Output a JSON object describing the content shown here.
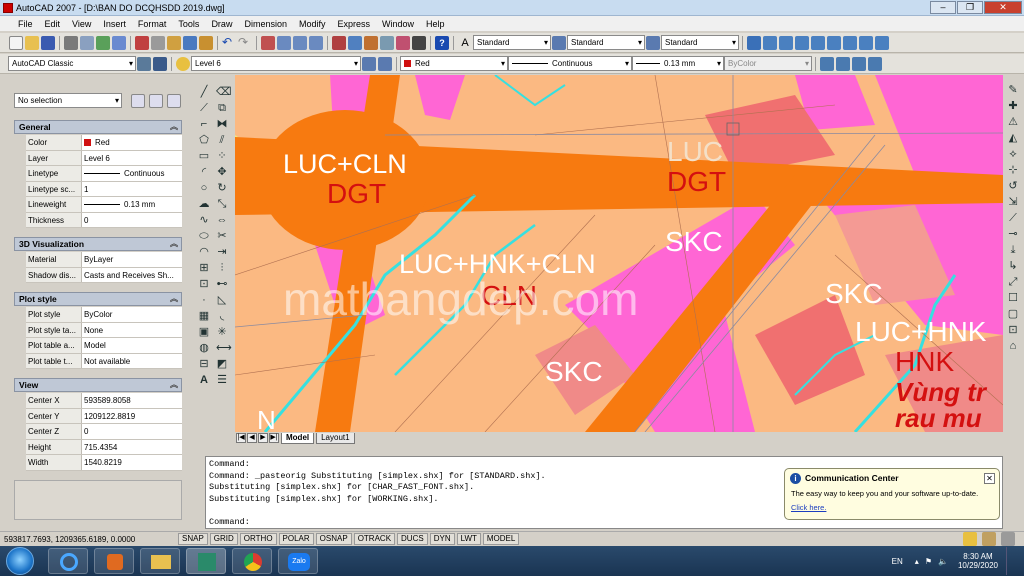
{
  "window": {
    "title": "AutoCAD 2007 - [D:\\BAN DO DCQHSDD 2019.dwg]"
  },
  "menu": [
    "File",
    "Edit",
    "View",
    "Insert",
    "Format",
    "Tools",
    "Draw",
    "Dimension",
    "Modify",
    "Express",
    "Window",
    "Help"
  ],
  "toolbar": {
    "text_style": "Standard",
    "dim_style": "Standard",
    "table_style": "Standard",
    "workspace": "AutoCAD Classic",
    "layer": "Level 6",
    "color": "Red",
    "linetype": "Continuous",
    "lineweight": "0.13 mm",
    "plotstyle": "ByColor"
  },
  "properties": {
    "selection": "No selection",
    "sections": [
      {
        "title": "General",
        "rows": [
          {
            "key": "Color",
            "value": "Red"
          },
          {
            "key": "Layer",
            "value": "Level 6"
          },
          {
            "key": "Linetype",
            "value": "Continuous"
          },
          {
            "key": "Linetype sc...",
            "value": "1"
          },
          {
            "key": "Lineweight",
            "value": "0.13 mm"
          },
          {
            "key": "Thickness",
            "value": "0"
          }
        ]
      },
      {
        "title": "3D Visualization",
        "rows": [
          {
            "key": "Material",
            "value": "ByLayer"
          },
          {
            "key": "Shadow dis...",
            "value": "Casts and Receives Sh..."
          }
        ]
      },
      {
        "title": "Plot style",
        "rows": [
          {
            "key": "Plot style",
            "value": "ByColor"
          },
          {
            "key": "Plot style ta...",
            "value": "None"
          },
          {
            "key": "Plot table a...",
            "value": "Model"
          },
          {
            "key": "Plot table t...",
            "value": "Not available"
          }
        ]
      },
      {
        "title": "View",
        "rows": [
          {
            "key": "Center X",
            "value": "593589.8058"
          },
          {
            "key": "Center Y",
            "value": "1209122.8819"
          },
          {
            "key": "Center Z",
            "value": "0"
          },
          {
            "key": "Height",
            "value": "715.4354"
          },
          {
            "key": "Width",
            "value": "1540.8219"
          }
        ]
      }
    ]
  },
  "map_labels": {
    "luc_cln": "LUC+CLN",
    "dgt1": "DGT",
    "luc": "LUC",
    "dgt2": "DGT",
    "luc_hnk_cln": "LUC+HNK+CLN",
    "cln": "CLN",
    "skc1": "SKC",
    "skc2": "SKC",
    "skc3": "SKC",
    "luc_hnk": "LUC+HNK",
    "hnk": "HNK",
    "vung1": "Vùng tr",
    "vung2": "rau mu",
    "watermark": "matbangdep.com",
    "n_label": "N"
  },
  "tabs": [
    "Model",
    "Layout1"
  ],
  "command_lines": [
    "Command:",
    "Command: _pasteorig Substituting [simplex.shx] for [STANDARD.shx].",
    "Substituting [simplex.shx] for [CHAR_FAST_FONT.shx].",
    "Substituting [simplex.shx] for [WORKING.shx].",
    "",
    "Command:"
  ],
  "communication_center": {
    "title": "Communication Center",
    "body": "The easy way to keep you and your software up-to-date.",
    "link": "Click here."
  },
  "status": {
    "coords": "593817.7693, 1209365.6189, 0.0000",
    "toggles": [
      "SNAP",
      "GRID",
      "ORTHO",
      "POLAR",
      "OSNAP",
      "OTRACK",
      "DUCS",
      "DYN",
      "LWT",
      "MODEL"
    ]
  },
  "taskbar": {
    "lang": "EN",
    "time": "8:30 AM",
    "date": "10/29/2020",
    "zalo": "Zalo"
  },
  "colors": {
    "orange_road": "#f77a10",
    "magenta": "#ff6ad0",
    "red_label": "#d41010",
    "cyan": "#36e0e0"
  }
}
